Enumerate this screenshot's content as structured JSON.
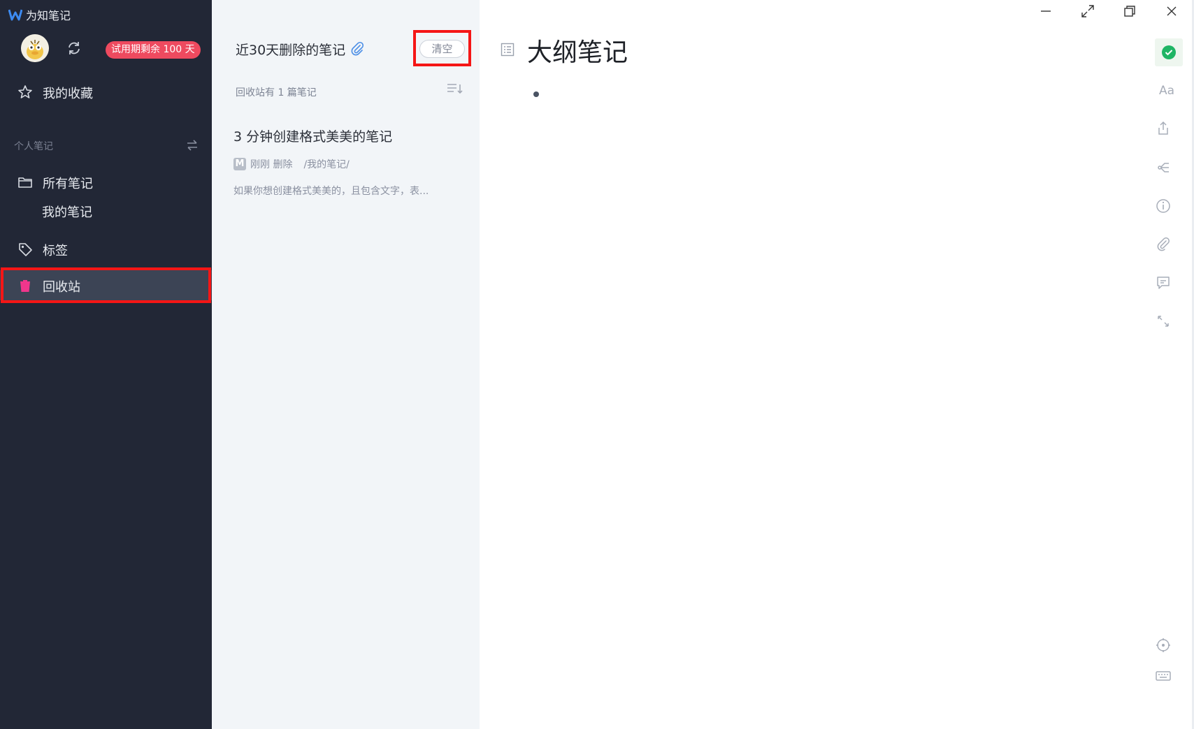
{
  "app": {
    "name": "为知笔记",
    "trial_badge": "试用期剩余 100 天"
  },
  "sidebar": {
    "favorites_label": "我的收藏",
    "section_label": "个人笔记",
    "all_notes_label": "所有笔记",
    "my_notes_label": "我的笔记",
    "tags_label": "标签",
    "recycle_label": "回收站"
  },
  "list": {
    "title": "近30天删除的笔记",
    "clear_label": "清空",
    "count_text": "回收站有 1 篇笔记",
    "notes": [
      {
        "title": "3 分钟创建格式美美的笔记",
        "badge": "M",
        "time": "刚刚 删除",
        "path": "/我的笔记/",
        "summary": "如果你想创建格式美美的，且包含文字，表..."
      }
    ]
  },
  "editor": {
    "title": "大纲笔记",
    "font_tool_label": "Aa"
  },
  "colors": {
    "sidebar_bg": "#222736",
    "list_bg": "#f2f5f8",
    "trial_badge": "#ee4a5f",
    "recycle_icon": "#f0368c",
    "highlight": "#f51616",
    "saved": "#1fb565"
  }
}
